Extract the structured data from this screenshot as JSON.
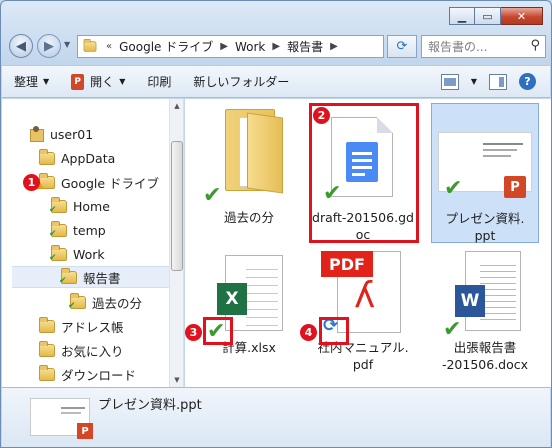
{
  "window": {
    "caption_min": "▁",
    "caption_max": "▭",
    "caption_close": "✕"
  },
  "address": {
    "chevron": "«",
    "crumbs": [
      "Google ドライブ",
      "Work",
      "報告書"
    ],
    "search_placeholder": "報告書の..."
  },
  "toolbar": {
    "organize": "整理",
    "open": "開く",
    "print": "印刷",
    "new_folder": "新しいフォルダー"
  },
  "tree": {
    "items": [
      {
        "label": "user01",
        "icon": "user-folder-icon"
      },
      {
        "label": "AppData",
        "icon": "folder-icon"
      },
      {
        "label": "Google ドライブ",
        "icon": "google-drive-folder-icon"
      },
      {
        "label": "Home",
        "icon": "folder-icon"
      },
      {
        "label": "temp",
        "icon": "folder-icon"
      },
      {
        "label": "Work",
        "icon": "folder-icon"
      },
      {
        "label": "報告書",
        "icon": "folder-icon"
      },
      {
        "label": "過去の分",
        "icon": "folder-icon"
      },
      {
        "label": "アドレス帳",
        "icon": "folder-icon"
      },
      {
        "label": "お気に入り",
        "icon": "folder-icon"
      },
      {
        "label": "ダウンロード",
        "icon": "folder-icon"
      }
    ]
  },
  "files": [
    {
      "name": "過去の分",
      "status": "synced"
    },
    {
      "name_line1": "draft-201506.gd",
      "name_line2": "oc",
      "status": "synced"
    },
    {
      "name_line1": "プレゼン資料.",
      "name_line2": "ppt",
      "status": "synced"
    },
    {
      "name": "計算.xlsx",
      "status": "synced",
      "icon_letter": "X"
    },
    {
      "name_line1": "社内マニュアル.",
      "name_line2": "pdf",
      "status": "syncing",
      "pdf_label": "PDF"
    },
    {
      "name_line1": "出張報告書",
      "name_line2": "-201506.docx",
      "status": "synced",
      "icon_letter": "W"
    }
  ],
  "annotations": [
    "1",
    "2",
    "3",
    "4"
  ],
  "details": {
    "filename": "プレゼン資料.ppt"
  },
  "colors": {
    "annotation_red": "#e0121e",
    "synced_green": "#3c9a2f",
    "syncing_blue": "#2f78c9",
    "selection": "#cce0f7"
  }
}
